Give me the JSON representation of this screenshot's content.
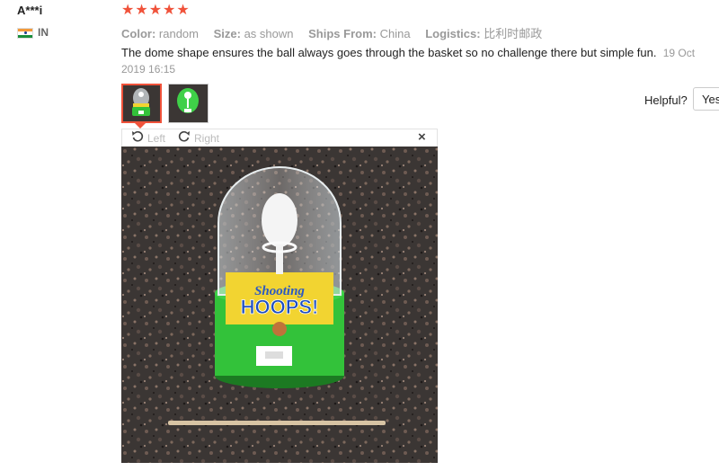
{
  "reviewer": {
    "name": "A***i",
    "country": "IN",
    "flag_icon": "india-flag-icon"
  },
  "rating": {
    "stars": 5,
    "max": 5,
    "color": "#f0523a"
  },
  "meta": {
    "color_label": "Color:",
    "color_value": "random",
    "size_label": "Size:",
    "size_value": "as shown",
    "ships_label": "Ships From:",
    "ships_value": "China",
    "logistics_label": "Logistics:",
    "logistics_value": "比利时邮政"
  },
  "review": {
    "text": "The dome shape ensures the ball always goes through the basket so no challenge there but simple fun.",
    "date": "19 Oct 2019 16:15"
  },
  "helpful": {
    "label": "Helpful?",
    "yes_label": "Yes"
  },
  "viewer": {
    "rotate_left_label": "Left",
    "rotate_right_label": "Right",
    "close_symbol": "×"
  },
  "photo": {
    "toy_title_line1": "Shooting",
    "toy_title_line2": "HOOPS!"
  },
  "colors": {
    "accent": "#f0523a",
    "muted_text": "#999999",
    "toy_base_green": "#33c23a",
    "granite": "#3b3634"
  }
}
